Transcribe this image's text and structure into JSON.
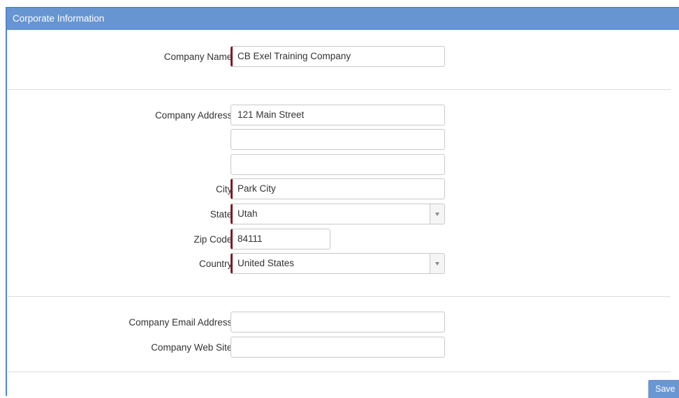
{
  "panel": {
    "title": "Corporate Information"
  },
  "company_name": {
    "label": "Company Name:",
    "value": "CB Exel Training Company"
  },
  "address": {
    "label": "Company Address:",
    "line1": "121 Main Street",
    "line2": "",
    "line3": ""
  },
  "city": {
    "label": "City:",
    "value": "Park City"
  },
  "state": {
    "label": "State:",
    "value": "Utah"
  },
  "zip": {
    "label": "Zip Code:",
    "value": "84111"
  },
  "country": {
    "label": "Country:",
    "value": "United States"
  },
  "email": {
    "label": "Company Email Address:",
    "value": ""
  },
  "website": {
    "label": "Company Web Site:",
    "value": ""
  },
  "actions": {
    "save_label": "Save"
  },
  "colors": {
    "header": "#6695d2",
    "required_marker": "#7b1a2a",
    "button": "#6a97d3"
  }
}
